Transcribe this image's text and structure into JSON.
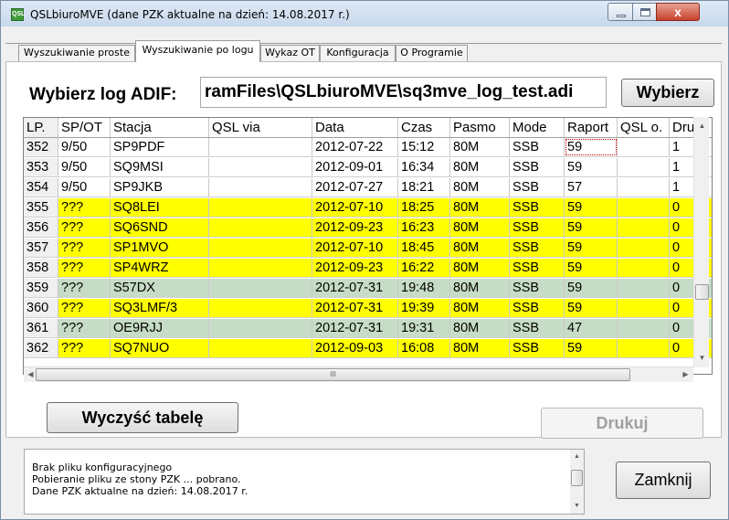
{
  "window": {
    "title": "QSLbiuroMVE (dane PZK aktualne na dzień: 14.08.2017 r.)",
    "icon_name": "qsl-app-icon",
    "close_glyph": "x"
  },
  "tabs": [
    {
      "label": "Wyszukiwanie proste",
      "active": false
    },
    {
      "label": "Wyszukiwanie po logu",
      "active": true
    },
    {
      "label": "Wykaz OT",
      "active": false
    },
    {
      "label": "Konfiguracja",
      "active": false
    },
    {
      "label": "O Programie",
      "active": false
    }
  ],
  "log_select": {
    "label": "Wybierz log ADIF:",
    "path": "ramFiles\\QSLbiuroMVE\\sq3mve_log_test.adi",
    "button": "Wybierz"
  },
  "table": {
    "columns": [
      "LP.",
      "SP/OT",
      "Stacja",
      "QSL via",
      "Data",
      "Czas",
      "Pasmo",
      "Mode",
      "Raport",
      "QSL o.",
      "Druk"
    ],
    "rows": [
      {
        "lp": "352",
        "spot": "9/50",
        "stacja": "SP9PDF",
        "qslvia": "",
        "data": "2012-07-22",
        "czas": "15:12",
        "pasmo": "80M",
        "mode": "SSB",
        "raport": "59",
        "qslo": "",
        "druk": "1",
        "status": "ok"
      },
      {
        "lp": "353",
        "spot": "9/50",
        "stacja": "SQ9MSI",
        "qslvia": "",
        "data": "2012-09-01",
        "czas": "16:34",
        "pasmo": "80M",
        "mode": "SSB",
        "raport": "59",
        "qslo": "",
        "druk": "1",
        "status": "ok"
      },
      {
        "lp": "354",
        "spot": "9/50",
        "stacja": "SP9JKB",
        "qslvia": "",
        "data": "2012-07-27",
        "czas": "18:21",
        "pasmo": "80M",
        "mode": "SSB",
        "raport": "57",
        "qslo": "",
        "druk": "1",
        "status": "ok"
      },
      {
        "lp": "355",
        "spot": "???",
        "stacja": "SQ8LEI",
        "qslvia": "",
        "data": "2012-07-10",
        "czas": "18:25",
        "pasmo": "80M",
        "mode": "SSB",
        "raport": "59",
        "qslo": "",
        "druk": "0",
        "status": "unknown"
      },
      {
        "lp": "356",
        "spot": "???",
        "stacja": "SQ6SND",
        "qslvia": "",
        "data": "2012-09-23",
        "czas": "16:23",
        "pasmo": "80M",
        "mode": "SSB",
        "raport": "59",
        "qslo": "",
        "druk": "0",
        "status": "unknown"
      },
      {
        "lp": "357",
        "spot": "???",
        "stacja": "SP1MVO",
        "qslvia": "",
        "data": "2012-07-10",
        "czas": "18:45",
        "pasmo": "80M",
        "mode": "SSB",
        "raport": "59",
        "qslo": "",
        "druk": "0",
        "status": "unknown"
      },
      {
        "lp": "358",
        "spot": "???",
        "stacja": "SP4WRZ",
        "qslvia": "",
        "data": "2012-09-23",
        "czas": "16:22",
        "pasmo": "80M",
        "mode": "SSB",
        "raport": "59",
        "qslo": "",
        "druk": "0",
        "status": "unknown"
      },
      {
        "lp": "359",
        "spot": "???",
        "stacja": "S57DX",
        "qslvia": "",
        "data": "2012-07-31",
        "czas": "19:48",
        "pasmo": "80M",
        "mode": "SSB",
        "raport": "59",
        "qslo": "",
        "druk": "0",
        "status": "foreign"
      },
      {
        "lp": "360",
        "spot": "???",
        "stacja": "SQ3LMF/3",
        "qslvia": "",
        "data": "2012-07-31",
        "czas": "19:39",
        "pasmo": "80M",
        "mode": "SSB",
        "raport": "59",
        "qslo": "",
        "druk": "0",
        "status": "unknown"
      },
      {
        "lp": "361",
        "spot": "???",
        "stacja": "OE9RJJ",
        "qslvia": "",
        "data": "2012-07-31",
        "czas": "19:31",
        "pasmo": "80M",
        "mode": "SSB",
        "raport": "47",
        "qslo": "",
        "druk": "0",
        "status": "foreign"
      },
      {
        "lp": "362",
        "spot": "???",
        "stacja": "SQ7NUO",
        "qslvia": "",
        "data": "2012-09-03",
        "czas": "16:08",
        "pasmo": "80M",
        "mode": "SSB",
        "raport": "59",
        "qslo": "",
        "druk": "0",
        "status": "unknown"
      }
    ],
    "row_colors": {
      "ok": "#ffffff",
      "unknown": "#ffff00",
      "foreign": "#c6dcc6"
    },
    "grid_color": "#c8c8c8",
    "hscroll_grip": "III"
  },
  "buttons": {
    "clear": "Wyczyść tabelę",
    "print": "Drukuj",
    "close": "Zamknij"
  },
  "log_messages": [
    "Brak pliku konfiguracyjnego",
    "Pobieranie pliku ze stony PZK ... pobrano.",
    "Dane PZK aktualne na dzień: 14.08.2017 r."
  ]
}
